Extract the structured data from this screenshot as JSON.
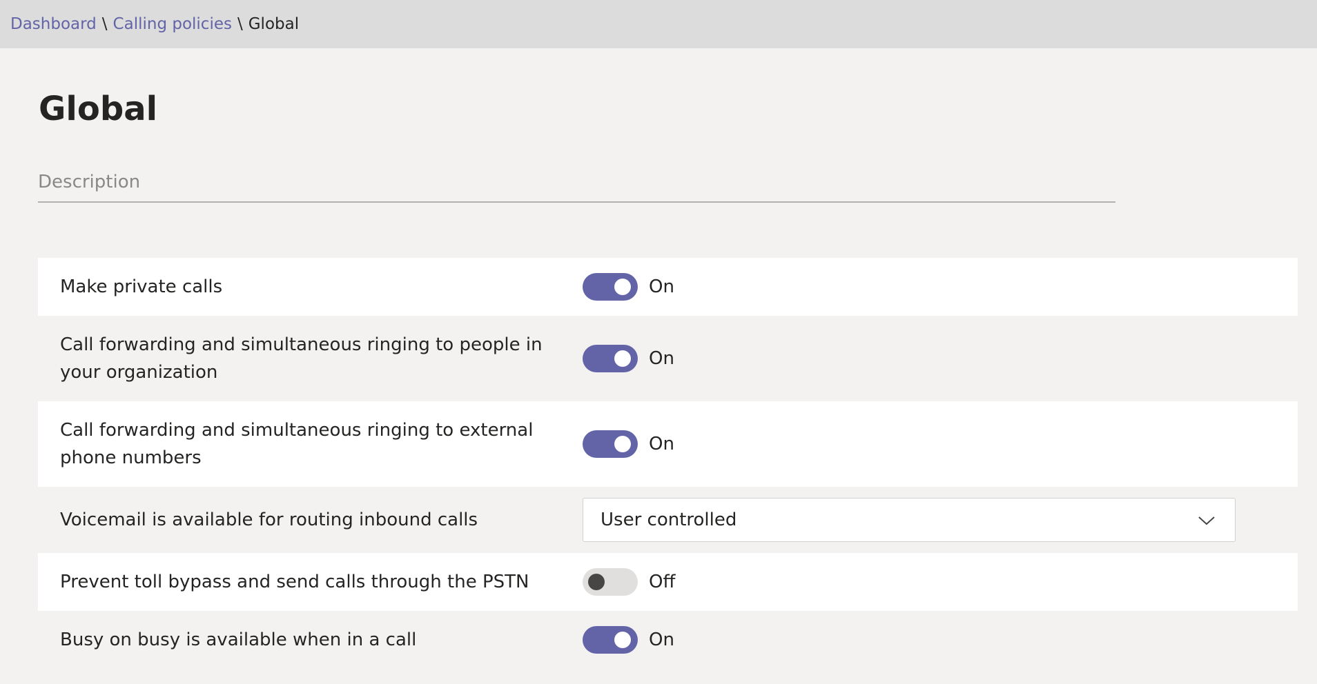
{
  "breadcrumb": {
    "items": [
      "Dashboard",
      "Calling policies"
    ],
    "separator": "\\",
    "current": "Global"
  },
  "page": {
    "title": "Global",
    "description_placeholder": "Description"
  },
  "settings": [
    {
      "label": "Make private calls",
      "type": "toggle",
      "state": "On"
    },
    {
      "label": "Call forwarding and simultaneous ringing to people in your organization",
      "type": "toggle",
      "state": "On"
    },
    {
      "label": "Call forwarding and simultaneous ringing to external phone numbers",
      "type": "toggle",
      "state": "On"
    },
    {
      "label": "Voicemail is available for routing inbound calls",
      "type": "dropdown",
      "value": "User controlled",
      "icon": "chevron-down-icon"
    },
    {
      "label": "Prevent toll bypass and send calls through the PSTN",
      "type": "toggle",
      "state": "Off"
    },
    {
      "label": "Busy on busy is available when in a call",
      "type": "toggle",
      "state": "On"
    }
  ],
  "colors": {
    "accent": "#6264a7",
    "toggle_off": "#e1dfdd",
    "breadcrumb_bg": "#dcdcdc",
    "page_bg": "#f3f2f1"
  }
}
